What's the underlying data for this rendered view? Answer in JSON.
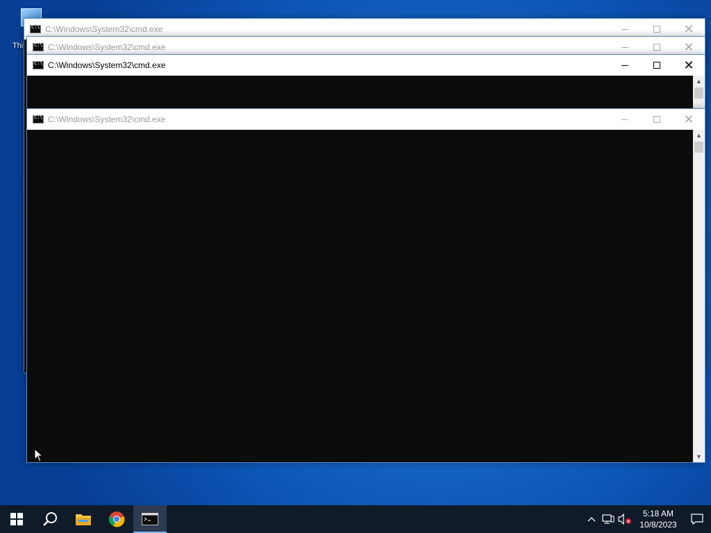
{
  "desktop": {
    "icon_label": "Thi"
  },
  "windows": [
    {
      "title": "C:\\Windows\\System32\\cmd.exe",
      "state": "inactive"
    },
    {
      "title": "C:\\Windows\\System32\\cmd.exe",
      "state": "inactive"
    },
    {
      "title": "C:\\Windows\\System32\\cmd.exe",
      "state": "active"
    },
    {
      "title": "C:\\Windows\\System32\\cmd.exe",
      "state": "inactive"
    }
  ],
  "window_controls": {
    "minimize_glyph": "",
    "maximize_glyph": "",
    "close_glyph": "✕"
  },
  "taskbar": {
    "start_icon": "windows-logo-icon",
    "search_icon": "search-icon",
    "pinned": [
      {
        "name": "file-explorer-icon"
      },
      {
        "name": "chrome-icon"
      },
      {
        "name": "cmd-icon",
        "active": true
      }
    ],
    "tray": {
      "chevron": "^",
      "time": "5:18 AM",
      "date": "10/8/2023"
    }
  },
  "colors": {
    "console_bg": "#0c0c0c",
    "taskbar_bg": "#101b2a",
    "accent": "#76b9ed"
  }
}
